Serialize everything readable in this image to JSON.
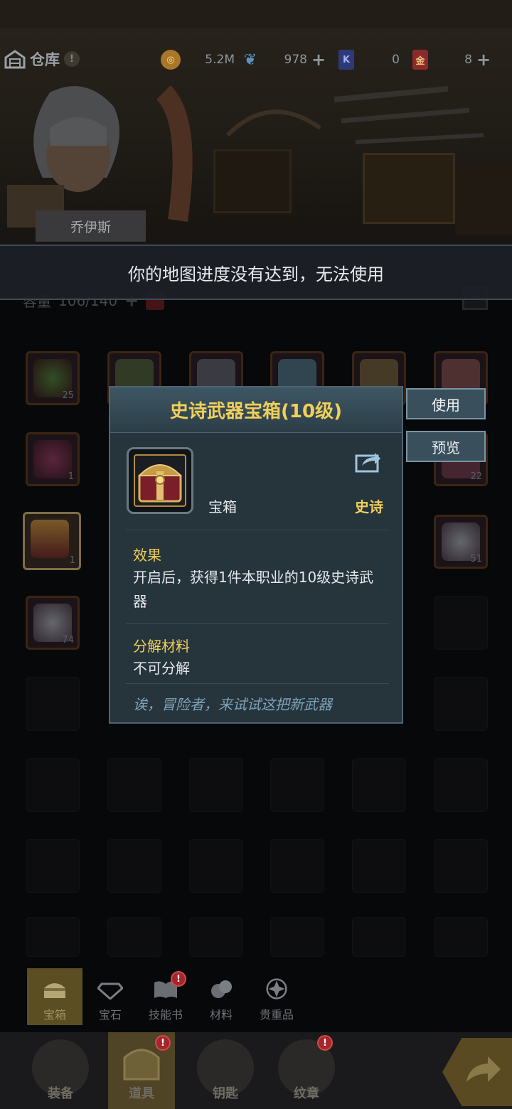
{
  "header": {
    "title": "仓库",
    "resources": [
      {
        "icon": "gold-coin-icon",
        "value": "5.2M",
        "has_plus": false
      },
      {
        "icon": "feather-icon",
        "value": "978",
        "has_plus": true
      },
      {
        "icon": "blue-card-icon",
        "value": "0",
        "has_plus": false
      },
      {
        "icon": "red-card-icon",
        "value": "8",
        "has_plus": true
      }
    ]
  },
  "hero": {
    "name": "乔伊斯"
  },
  "warning": "你的地图进度没有达到，无法使用",
  "capacity": {
    "label": "容量",
    "value": "106/140"
  },
  "grid": {
    "items": [
      {
        "count": "25"
      },
      {
        "count": ""
      },
      {
        "count": ""
      },
      {
        "count": ""
      },
      {
        "count": ""
      },
      {
        "count": ""
      },
      {
        "count": "1"
      },
      {
        "count": "22"
      },
      {
        "count": "1"
      },
      {
        "count": "51"
      },
      {
        "count": "74"
      }
    ]
  },
  "popup": {
    "title": "史诗武器宝箱(10级)",
    "type": "宝箱",
    "rarity": "史诗",
    "effect_title": "效果",
    "effect_text": "开启后，获得1件本职业的10级史诗武器",
    "decompose_title": "分解材料",
    "decompose_text": "不可分解",
    "flavor": "诶，冒险者，来试试这把新武器"
  },
  "actions": {
    "use": "使用",
    "preview": "预览"
  },
  "category_tabs": [
    {
      "label": "宝箱",
      "icon": "chest-icon",
      "active": true,
      "alert": false
    },
    {
      "label": "宝石",
      "icon": "gem-icon",
      "active": false,
      "alert": false
    },
    {
      "label": "技能书",
      "icon": "book-icon",
      "active": false,
      "alert": true
    },
    {
      "label": "材料",
      "icon": "material-icon",
      "active": false,
      "alert": false
    },
    {
      "label": "贵重品",
      "icon": "valuable-icon",
      "active": false,
      "alert": false
    }
  ],
  "bottom_nav": [
    {
      "label": "装备",
      "icon": "equipment-icon",
      "active": false,
      "alert": false
    },
    {
      "label": "道具",
      "icon": "props-icon",
      "active": true,
      "alert": true
    },
    {
      "label": "钥匙",
      "icon": "key-icon",
      "active": false,
      "alert": false
    },
    {
      "label": "纹章",
      "icon": "emblem-icon",
      "active": false,
      "alert": true
    }
  ],
  "colors": {
    "accent_gold": "#f0cf5a",
    "popup_bg": "#26343c",
    "button_bg": "#3a4f5c",
    "alert_red": "#a4262b"
  }
}
